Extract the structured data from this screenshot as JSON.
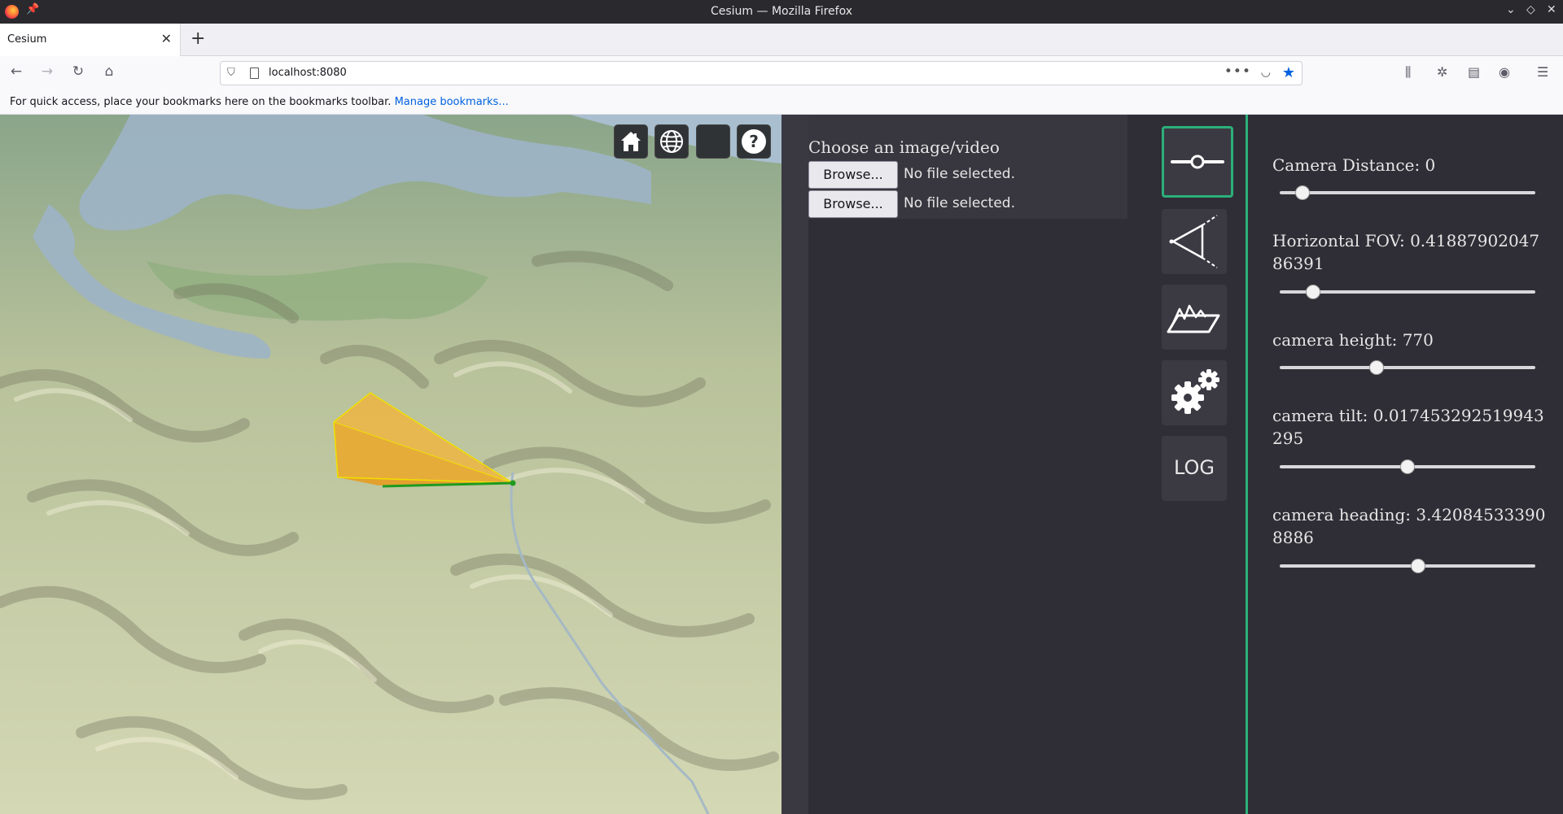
{
  "window": {
    "title": "Cesium — Mozilla Firefox"
  },
  "tab": {
    "title": "Cesium",
    "close": "✕",
    "new_tab": "+"
  },
  "nav": {
    "url": "localhost:8080",
    "more_dots": "•••"
  },
  "bookmarks": {
    "message": "For quick access, place your bookmarks here on the bookmarks toolbar.",
    "link": "Manage bookmarks..."
  },
  "file_panel": {
    "label": "Choose an image/video",
    "inputs": [
      {
        "button": "Browse...",
        "status": "No file selected."
      },
      {
        "button": "Browse...",
        "status": "No file selected."
      }
    ]
  },
  "tools": {
    "items": [
      {
        "name": "sliders-tool",
        "icon": "slider-icon",
        "active": true
      },
      {
        "name": "camera-frustum-tool",
        "icon": "frustum-icon",
        "active": false
      },
      {
        "name": "terrain-tool",
        "icon": "terrain-icon",
        "active": false
      },
      {
        "name": "settings-tool",
        "icon": "gears-icon",
        "active": false
      },
      {
        "name": "log-tool",
        "label": "LOG",
        "active": false
      }
    ]
  },
  "params": [
    {
      "label": "Camera Distance: 0",
      "fraction": 0.09
    },
    {
      "label": "Horizontal FOV: 0.4188790204786391",
      "fraction": 0.13
    },
    {
      "label": "camera height: 770",
      "fraction": 0.38
    },
    {
      "label": "camera tilt: 0.017453292519943295",
      "fraction": 0.5
    },
    {
      "label": "camera heading: 3.420845333908886",
      "fraction": 0.54
    }
  ],
  "colors": {
    "accent": "#2bb07a",
    "frustum": "#f5b335",
    "frustum_edge": "#f0e000",
    "ground_line": "#1f9a1f"
  }
}
